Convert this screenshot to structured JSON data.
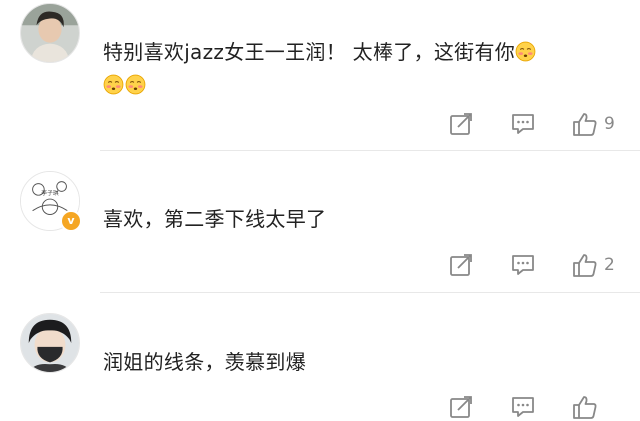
{
  "comments": [
    {
      "text": "特别喜欢jazz女王一王润！ 太棒了，这街有你",
      "emoji_name": "shy-blush-emoji",
      "emoji_count": 3,
      "likes": "9",
      "verified": false
    },
    {
      "text": "喜欢，第二季下线太早了",
      "avatar_text": "李子琪",
      "likes": "2",
      "verified": true,
      "badge": "v"
    },
    {
      "text": "润姐的线条，羡慕到爆",
      "likes": "",
      "verified": false
    }
  ],
  "icons": {
    "share": "share-icon",
    "comment": "comment-icon",
    "like": "thumbs-up-icon"
  },
  "colors": {
    "text": "#222222",
    "icon": "#888888",
    "divider": "#e8e8e8",
    "badge": "#f5a623"
  }
}
